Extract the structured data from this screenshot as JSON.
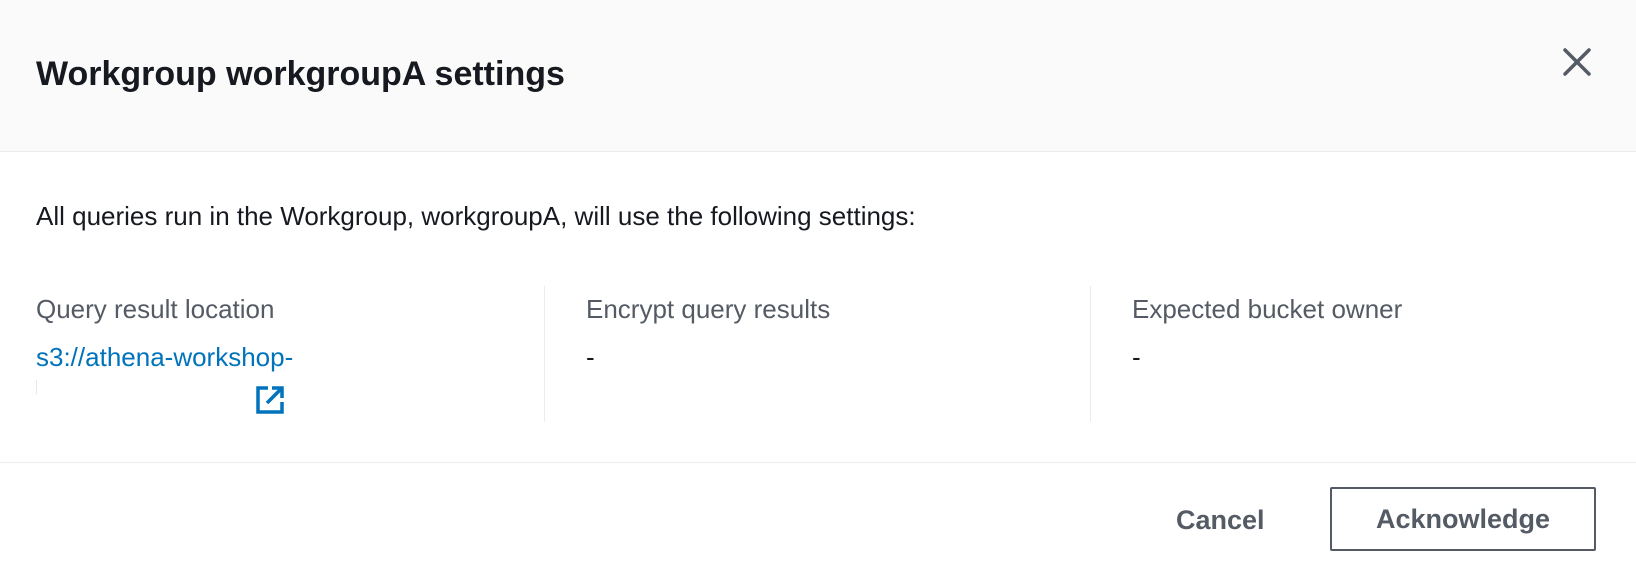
{
  "dialog": {
    "title": "Workgroup workgroupA settings",
    "close_icon": "close-icon",
    "intro": "All queries run in the Workgroup, workgroupA, will use the following settings:"
  },
  "settings": {
    "query_result_location": {
      "label": "Query result location",
      "value": "s3://athena-workshop-",
      "icon": "external-link-icon"
    },
    "encrypt_query_results": {
      "label": "Encrypt query results",
      "value": "-"
    },
    "expected_bucket_owner": {
      "label": "Expected bucket owner",
      "value": "-"
    }
  },
  "footer": {
    "cancel_label": "Cancel",
    "acknowledge_label": "Acknowledge"
  },
  "colors": {
    "link": "#0073bb",
    "text": "#16191f",
    "secondary_text": "#545b64",
    "header_bg": "#fafafa",
    "divider": "#eaeded"
  }
}
